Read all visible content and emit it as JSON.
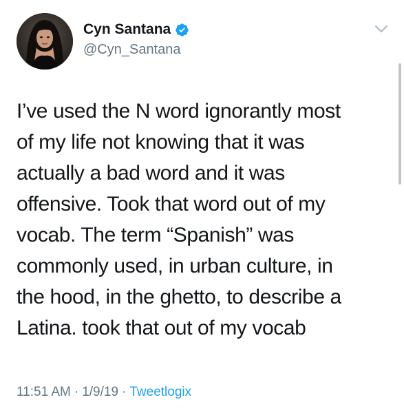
{
  "user": {
    "display_name": "Cyn Santana",
    "handle": "@Cyn_Santana",
    "verified": true,
    "avatar_icon": "profile-photo"
  },
  "tweet": {
    "lines": [
      "I’ve used the N word ignorantly most",
      "of my life not knowing that it was",
      "actually a bad word and it was",
      "offensive. Took that word out of my",
      "vocab. The term “Spanish” was",
      "commonly used, in urban culture, in",
      "the hood, in the ghetto, to describe a",
      "Latina. took that out of my vocab"
    ]
  },
  "meta": {
    "time": "11:51 AM",
    "separator": "·",
    "date": "1/9/19",
    "source": "Tweetlogix"
  },
  "colors": {
    "text": "#14171a",
    "muted": "#657786",
    "link": "#1da1f2",
    "verified": "#1da1f2"
  }
}
